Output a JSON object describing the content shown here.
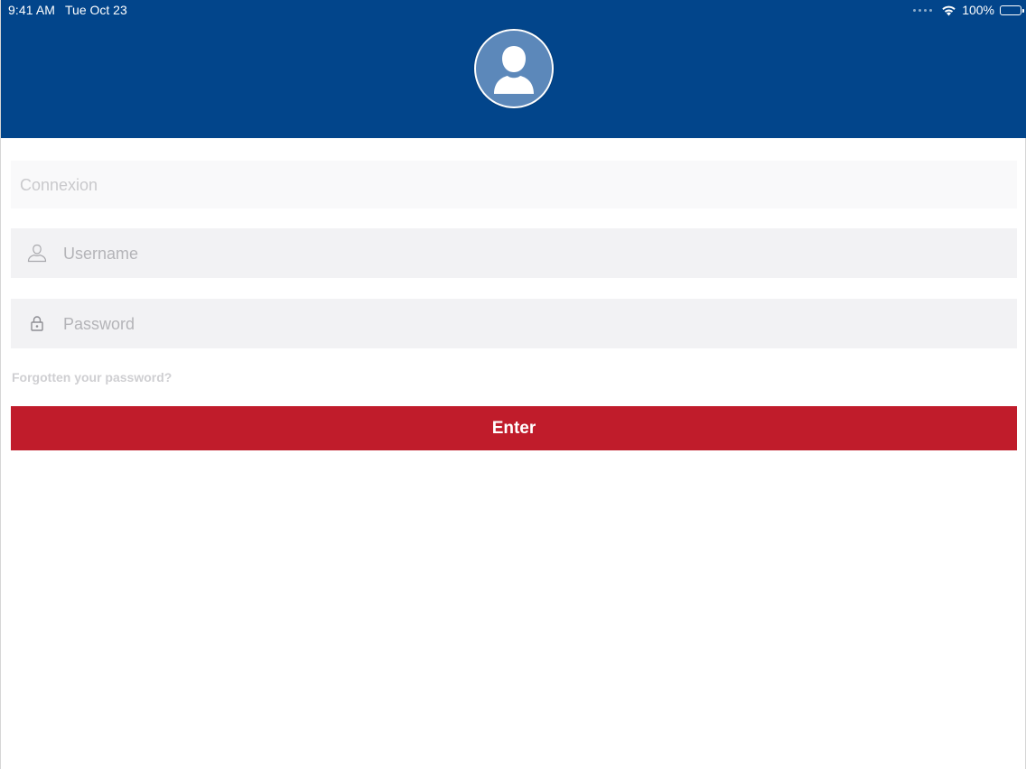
{
  "status_bar": {
    "time": "9:41 AM",
    "date": "Tue Oct 23",
    "battery": "100%",
    "battery_level": 1.0,
    "icons": [
      "signal-dots-icon",
      "wifi-icon",
      "battery-icon"
    ]
  },
  "header": {
    "background_color": "#02458b",
    "avatar_icon": "user-avatar-icon"
  },
  "form": {
    "connexion_placeholder": "Connexion",
    "username_placeholder": "Username",
    "username_icon": "user-outline-icon",
    "password_placeholder": "Password",
    "password_icon": "lock-icon",
    "forgot_password": "Forgotten your password?",
    "enter_label": "Enter",
    "enter_color": "#c01c2b"
  }
}
